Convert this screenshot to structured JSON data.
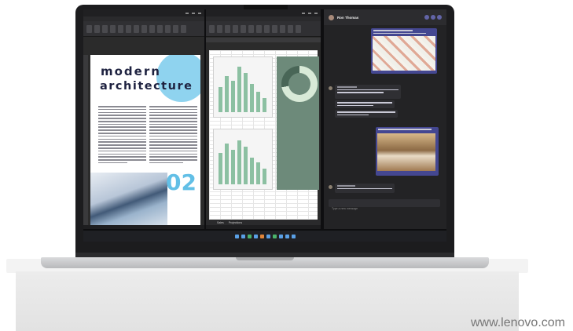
{
  "word": {
    "title_line1": "modern",
    "title_line2": "architecture",
    "page_number": "02"
  },
  "excel": {
    "sheet_tabs": [
      "Sales",
      "Projections"
    ]
  },
  "teams": {
    "contact_name": "Ron Thomas",
    "compose_placeholder": "Type a new message"
  },
  "watermark": "www.lenovo.com",
  "colors": {
    "page_accent": "#8fd3ef",
    "title_text": "#1e2240",
    "excel_panel": "#6d8a7a",
    "teams_bubble": "#444791"
  }
}
